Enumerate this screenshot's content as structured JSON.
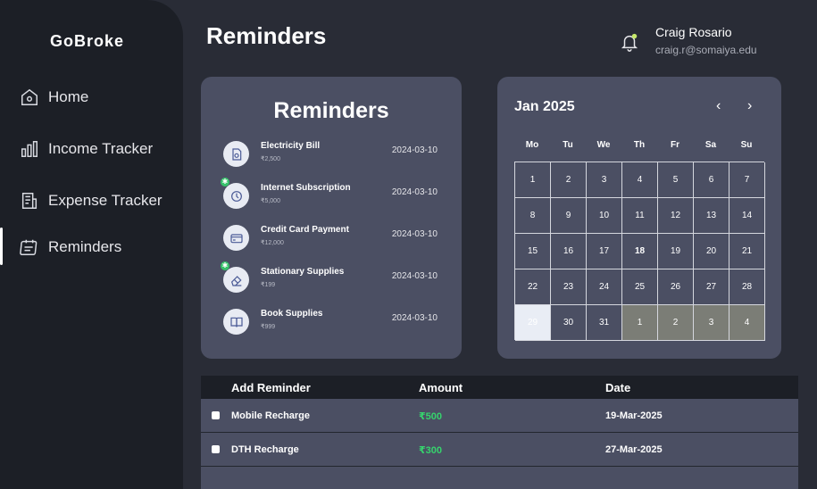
{
  "app": {
    "brand": "GoBroke",
    "page_title": "Reminders"
  },
  "sidebar": {
    "items": [
      {
        "label": "Home",
        "icon": "home-icon"
      },
      {
        "label": "Income Tracker",
        "icon": "bar-chart-icon"
      },
      {
        "label": "Expense Tracker",
        "icon": "receipt-icon"
      },
      {
        "label": "Reminders",
        "icon": "calendar-icon",
        "active": true
      }
    ]
  },
  "user": {
    "name": "Craig Rosario",
    "email": "craig.r@somaiya.edu",
    "icon": "bell-icon"
  },
  "reminders_card": {
    "title": "Reminders",
    "items": [
      {
        "name": "Electricity Bill",
        "amount": "₹2,500",
        "date": "2024-03-10",
        "icon": "bulb-icon",
        "new": false
      },
      {
        "name": "Internet Subscription",
        "amount": "₹5,000",
        "date": "2024-03-10",
        "icon": "clock-icon",
        "new": true
      },
      {
        "name": "Credit Card Payment",
        "amount": "₹12,000",
        "date": "2024-03-10",
        "icon": "credit-card-icon",
        "new": false
      },
      {
        "name": "Stationary Supplies",
        "amount": "₹199",
        "date": "2024-03-10",
        "icon": "eraser-icon",
        "new": true
      },
      {
        "name": "Book Supplies",
        "amount": "₹999",
        "date": "2024-03-10",
        "icon": "book-icon",
        "new": false
      }
    ]
  },
  "calendar": {
    "title": "Jan 2025",
    "prev": "‹",
    "next": "›",
    "weekdays": [
      "Mo",
      "Tu",
      "We",
      "Th",
      "Fr",
      "Sa",
      "Su"
    ],
    "days": [
      "1",
      "2",
      "3",
      "4",
      "5",
      "6",
      "7",
      "8",
      "9",
      "10",
      "11",
      "12",
      "13",
      "14",
      "15",
      "16",
      "17",
      "18",
      "19",
      "20",
      "21",
      "22",
      "23",
      "24",
      "25",
      "26",
      "27",
      "28",
      "29",
      "30",
      "31",
      "1",
      "2",
      "3",
      "4"
    ],
    "today": "29",
    "highlight": "18"
  },
  "table": {
    "headers": [
      "Add Reminder",
      "Amount",
      "Date"
    ],
    "rows": [
      {
        "name": "Mobile Recharge",
        "amount": "₹500",
        "date": "19-Mar-2025"
      },
      {
        "name": "DTH Recharge",
        "amount": "₹300",
        "date": "27-Mar-2025"
      }
    ]
  },
  "colors": {
    "accent_green": "#36d46d",
    "card": "#4b4f63",
    "sidebar": "#1c1f26",
    "background": "#292c36"
  }
}
